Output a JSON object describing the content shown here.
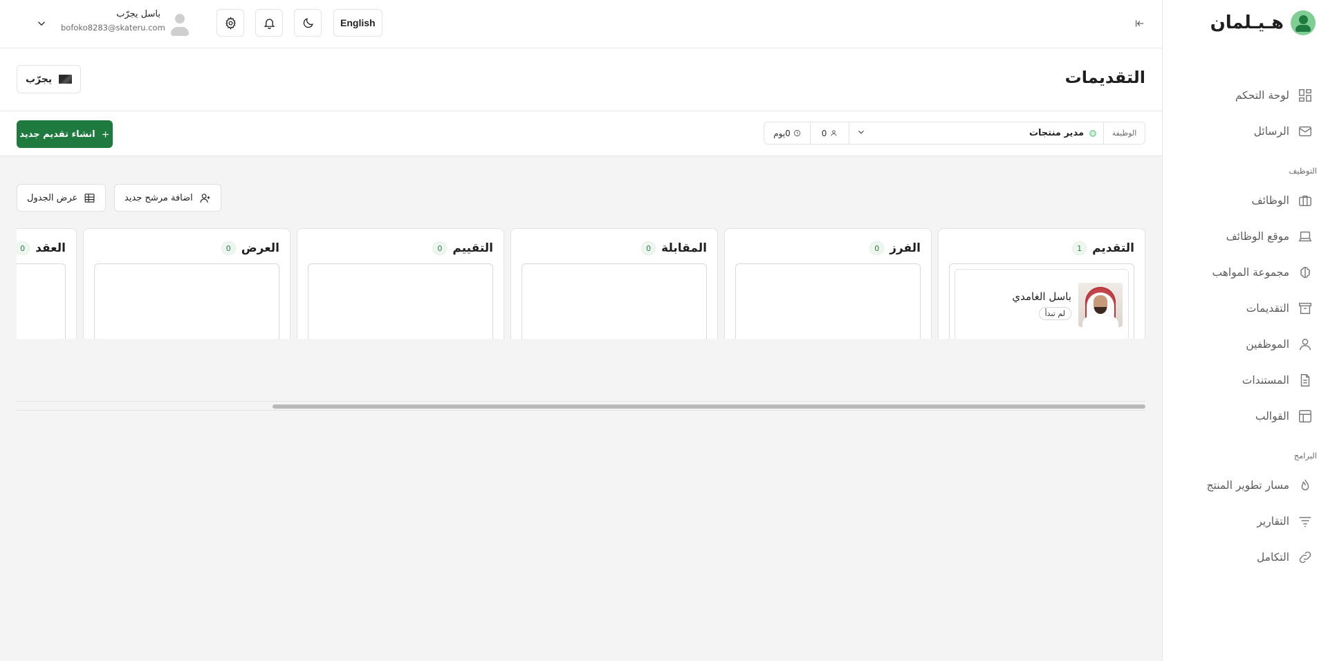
{
  "app": {
    "brand_name": "هـيـلمان"
  },
  "sidebar": {
    "top_items": [
      {
        "label": "لوحة التحكم",
        "icon": "grid-icon"
      },
      {
        "label": "الرسائل",
        "icon": "mail-icon"
      }
    ],
    "section_hiring": "التوظيف",
    "hiring_items": [
      {
        "label": "الوظائف",
        "icon": "briefcase-icon"
      },
      {
        "label": "موقع الوظائف",
        "icon": "laptop-icon"
      },
      {
        "label": "مجموعة المواهب",
        "icon": "brain-icon"
      },
      {
        "label": "التقديمات",
        "icon": "archive-icon"
      },
      {
        "label": "الموظفين",
        "icon": "user-icon"
      },
      {
        "label": "المستندات",
        "icon": "file-icon"
      },
      {
        "label": "القوالب",
        "icon": "layout-icon"
      }
    ],
    "section_programs": "البرامج",
    "program_items": [
      {
        "label": "مسار تطوير المنتج",
        "icon": "flame-icon"
      },
      {
        "label": "التقارير",
        "icon": "filter-lines-icon"
      },
      {
        "label": "التكامل",
        "icon": "link-icon"
      }
    ]
  },
  "topbar": {
    "language_label": "English",
    "user_name": "باسل يجرّب",
    "user_email": "bofoko8283@skateru.com"
  },
  "page": {
    "title": "التقديمات",
    "company_name": "يجرّب"
  },
  "filter": {
    "job_label": "الوظيفة",
    "job_value": "مدير منتجات",
    "applicants_count": "0",
    "days": "0يوم",
    "create_button": "انشاء تقديم جديد"
  },
  "board": {
    "add_candidate_button": "اضافة مرشح جديد",
    "table_view_button": "عرض الجدول",
    "columns": [
      {
        "title": "التقديم",
        "count": "1"
      },
      {
        "title": "الفرز",
        "count": "0"
      },
      {
        "title": "المقابلة",
        "count": "0"
      },
      {
        "title": "التقييم",
        "count": "0"
      },
      {
        "title": "العرض",
        "count": "0"
      },
      {
        "title": "العقد",
        "count": "0"
      }
    ],
    "candidate": {
      "name": "باسل الغامدي",
      "status": "لم تبدأ"
    }
  },
  "colors": {
    "accent": "#1f7a3f",
    "brand_light": "#7fcf95",
    "board_bg": "#f4f4f4"
  }
}
